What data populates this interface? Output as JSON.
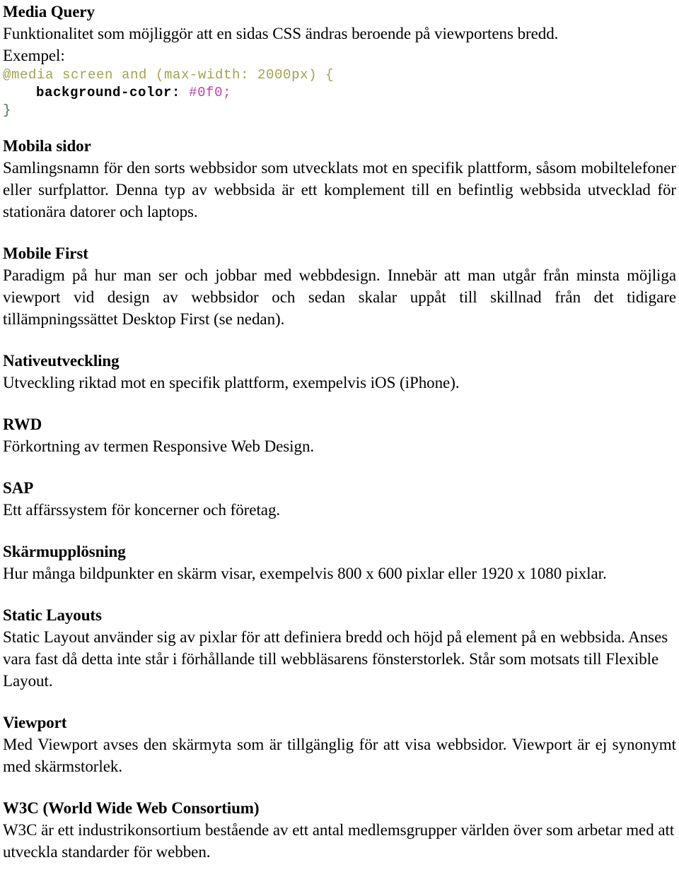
{
  "document": {
    "language": "sv",
    "sections": [
      {
        "id": "media-query",
        "heading": "Media Query",
        "paragraphs": [
          "Funktionalitet som möjliggör att en sidas CSS ändras beroende på viewportens bredd.",
          "Exempel:"
        ],
        "code_block": {
          "language": "css",
          "lines": [
            "@media screen and (max-width: 2000px) {",
            "    background-color: #0f0;",
            "}"
          ],
          "tokens": {
            "selector_line": "@media screen and (max-width: 2000px) {",
            "property": "background-color",
            "colon": ":",
            "value": "#0f0;",
            "closing_brace": "}"
          },
          "colors": {
            "selector": "#a3a24f",
            "property": "#000000",
            "value": "#c13fa8",
            "closing_brace": "#3f7a45"
          }
        }
      },
      {
        "id": "mobila-sidor",
        "heading": "Mobila sidor",
        "paragraphs": [
          "Samlingsnamn för den sorts webbsidor som utvecklats mot en specifik plattform, såsom mobiltelefoner eller surfplattor. Denna typ av webbsida är ett komplement till en befintlig webbsida utvecklad för stationära datorer och laptops."
        ]
      },
      {
        "id": "mobile-first",
        "heading": "Mobile First",
        "paragraphs": [
          "Paradigm på hur man ser och jobbar med webbdesign. Innebär att man utgår från minsta möjliga viewport vid design av webbsidor och sedan skalar uppåt till skillnad från det tidigare tillämpningssättet Desktop First (se nedan)."
        ]
      },
      {
        "id": "nativeutveckling",
        "heading": "Nativeutveckling",
        "paragraphs": [
          "Utveckling riktad mot en specifik plattform, exempelvis iOS (iPhone)."
        ]
      },
      {
        "id": "rwd",
        "heading": "RWD",
        "paragraphs": [
          "Förkortning av termen Responsive Web Design."
        ]
      },
      {
        "id": "sap",
        "heading": "SAP",
        "paragraphs": [
          "Ett affärssystem för koncerner och företag."
        ]
      },
      {
        "id": "skarmupplosning",
        "heading": "Skärmupplösning",
        "paragraphs": [
          "Hur många bildpunkter en skärm visar, exempelvis 800 x 600 pixlar eller 1920 x 1080 pixlar."
        ]
      },
      {
        "id": "static-layouts",
        "heading": "Static Layouts",
        "paragraphs": [
          "Static Layout använder sig av pixlar för att definiera bredd och höjd på element på en webbsida. Anses vara fast då detta inte står i förhållande till webbläsarens fönsterstorlek. Står som motsats till Flexible Layout."
        ]
      },
      {
        "id": "viewport",
        "heading": "Viewport",
        "paragraphs": [
          "Med Viewport avses den skärmyta som är tillgänglig för att visa webbsidor. Viewport är ej synonymt med skärmstorlek."
        ]
      },
      {
        "id": "w3c",
        "heading": "W3C (World Wide Web Consortium)",
        "paragraphs": [
          "W3C är ett industrikonsortium bestående av ett antal medlemsgrupper världen över som arbetar med att utveckla standarder för webben."
        ]
      }
    ]
  }
}
